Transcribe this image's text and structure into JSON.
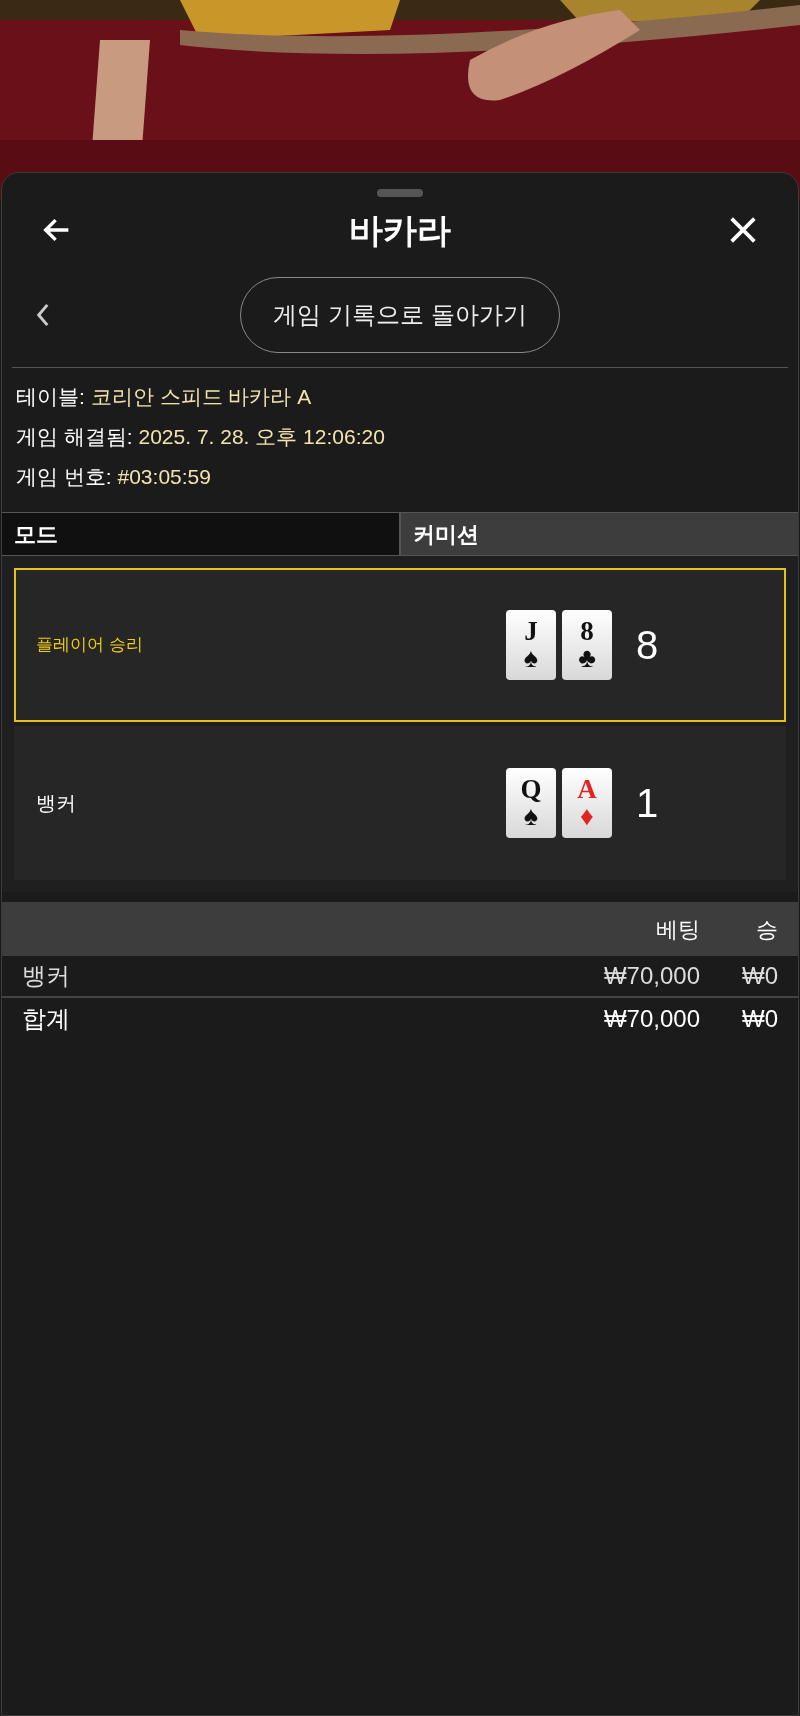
{
  "header": {
    "title": "바카라"
  },
  "back_button": {
    "label": "게임 기록으로 돌아가기"
  },
  "info": [
    {
      "label": "테이블:",
      "value": "코리안 스피드 바카라 A"
    },
    {
      "label": "게임 해결됨:",
      "value": "2025. 7. 28. 오후 12:06:20"
    },
    {
      "label": "게임 번호:",
      "value": "#03:05:59"
    }
  ],
  "tabs": [
    {
      "label": "모드",
      "selected": true
    },
    {
      "label": "커미션",
      "selected": false
    }
  ],
  "hands": [
    {
      "name": "플레이어 승리",
      "winner": true,
      "score": "8",
      "cards": [
        {
          "rank": "J",
          "suit": "♠",
          "color": "#111111"
        },
        {
          "rank": "8",
          "suit": "♣",
          "color": "#111111"
        }
      ]
    },
    {
      "name": "뱅커",
      "winner": false,
      "score": "1",
      "cards": [
        {
          "rank": "Q",
          "suit": "♠",
          "color": "#111111"
        },
        {
          "rank": "A",
          "suit": "♦",
          "color": "#e02424"
        }
      ]
    }
  ],
  "table": {
    "columns": [
      "베팅",
      "승"
    ],
    "rows": [
      {
        "label": "뱅커",
        "bet": "₩70,000",
        "win": "₩0"
      },
      {
        "label": "합계",
        "bet": "₩70,000",
        "win": "₩0"
      }
    ]
  }
}
